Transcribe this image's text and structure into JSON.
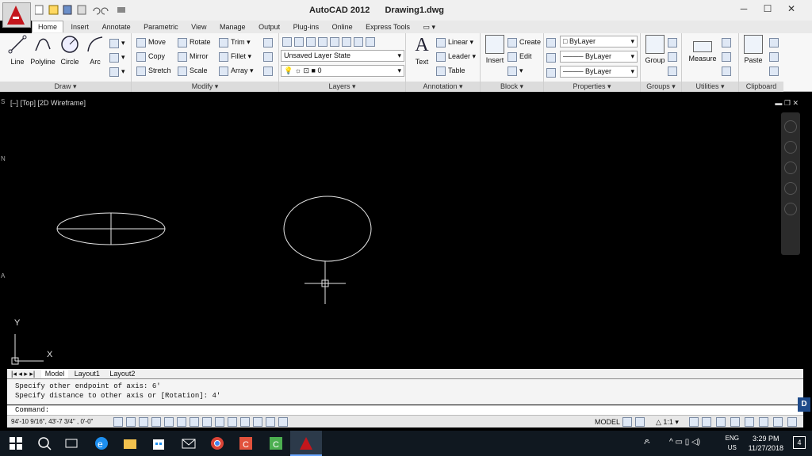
{
  "title": {
    "app": "AutoCAD 2012",
    "file": "Drawing1.dwg"
  },
  "tabs": [
    "Home",
    "Insert",
    "Annotate",
    "Parametric",
    "View",
    "Manage",
    "Output",
    "Plug-ins",
    "Online",
    "Express Tools"
  ],
  "panels": {
    "draw": {
      "title": "Draw ▾",
      "tools": [
        "Line",
        "Polyline",
        "Circle",
        "Arc"
      ]
    },
    "modify": {
      "title": "Modify ▾",
      "tools": [
        "Move",
        "Rotate",
        "Trim",
        "Copy",
        "Mirror",
        "Fillet",
        "Stretch",
        "Scale",
        "Array"
      ]
    },
    "layers": {
      "title": "Layers ▾",
      "state": "Unsaved Layer State",
      "current": "0"
    },
    "annotation": {
      "title": "Annotation ▾",
      "text": "Text",
      "tools": [
        "Linear",
        "Leader",
        "Table"
      ]
    },
    "block": {
      "title": "Block ▾",
      "insert": "Insert",
      "tools": [
        "Create",
        "Edit"
      ]
    },
    "properties": {
      "title": "Properties ▾",
      "color": "ByLayer",
      "linetype": "ByLayer",
      "lineweight": "ByLayer"
    },
    "groups": {
      "title": "Groups ▾",
      "group": "Group"
    },
    "utilities": {
      "title": "Utilities ▾",
      "measure": "Measure"
    },
    "clipboard": {
      "title": "Clipboard",
      "paste": "Paste"
    }
  },
  "viewport": {
    "label": "[–] [Top] [2D Wireframe]",
    "ucs_x": "X",
    "ucs_y": "Y"
  },
  "layout_tabs": [
    "Model",
    "Layout1",
    "Layout2"
  ],
  "command": {
    "history": [
      "Specify other endpoint of axis: 6'",
      "Specify distance to other axis or [Rotation]: 4'"
    ],
    "prompt": "Command:"
  },
  "status": {
    "coords": "94'-10 9/16\", 43'-7 3/4\" , 0'-0\"",
    "model": "MODEL",
    "scale": "1:1 ▾"
  },
  "taskbar": {
    "lang": "ENG",
    "region": "US",
    "time": "3:29 PM",
    "date": "11/27/2018",
    "notifications": "4"
  },
  "colors": {
    "accent": "#c4161c",
    "viewport_bg": "#000000",
    "drawing": "#e6e6e6"
  }
}
